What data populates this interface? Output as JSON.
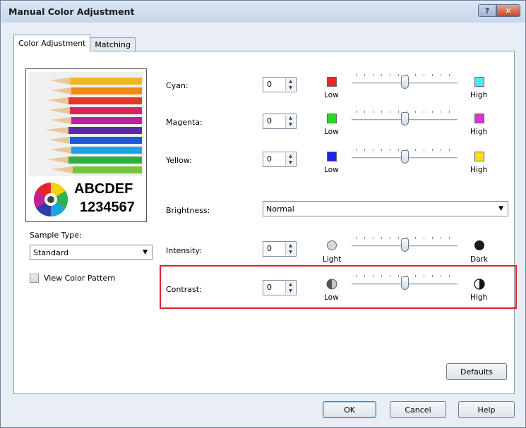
{
  "window": {
    "title": "Manual Color Adjustment",
    "help_symbol": "?",
    "close_symbol": "✕"
  },
  "tabs": [
    {
      "label": "Color Adjustment",
      "active": true
    },
    {
      "label": "Matching",
      "active": false
    }
  ],
  "sample": {
    "text_line1": "ABCDEF",
    "text_line2": "1234567",
    "sample_type_label": "Sample Type:",
    "sample_type_value": "Standard",
    "view_color_pattern_label": "View Color Pattern",
    "view_color_pattern_checked": false
  },
  "adjustments": {
    "cyan": {
      "label": "Cyan:",
      "value": "0",
      "low_label": "Low",
      "high_label": "High",
      "low_color": "#e8262b",
      "high_color": "#3ff0f0"
    },
    "magenta": {
      "label": "Magenta:",
      "value": "0",
      "low_label": "Low",
      "high_label": "High",
      "low_color": "#22d82a",
      "high_color": "#e02fd8"
    },
    "yellow": {
      "label": "Yellow:",
      "value": "0",
      "low_label": "Low",
      "high_label": "High",
      "low_color": "#1c24e0",
      "high_color": "#f6dd18"
    },
    "brightness": {
      "label": "Brightness:",
      "value": "Normal"
    },
    "intensity": {
      "label": "Intensity:",
      "value": "0",
      "low_label": "Light",
      "high_label": "Dark"
    },
    "contrast": {
      "label": "Contrast:",
      "value": "0",
      "low_label": "Low",
      "high_label": "High"
    }
  },
  "buttons": {
    "defaults": "Defaults",
    "ok": "OK",
    "cancel": "Cancel",
    "help": "Help"
  },
  "colors": {
    "highlight_border": "#e0242b",
    "window_background": "#e9eef6"
  }
}
